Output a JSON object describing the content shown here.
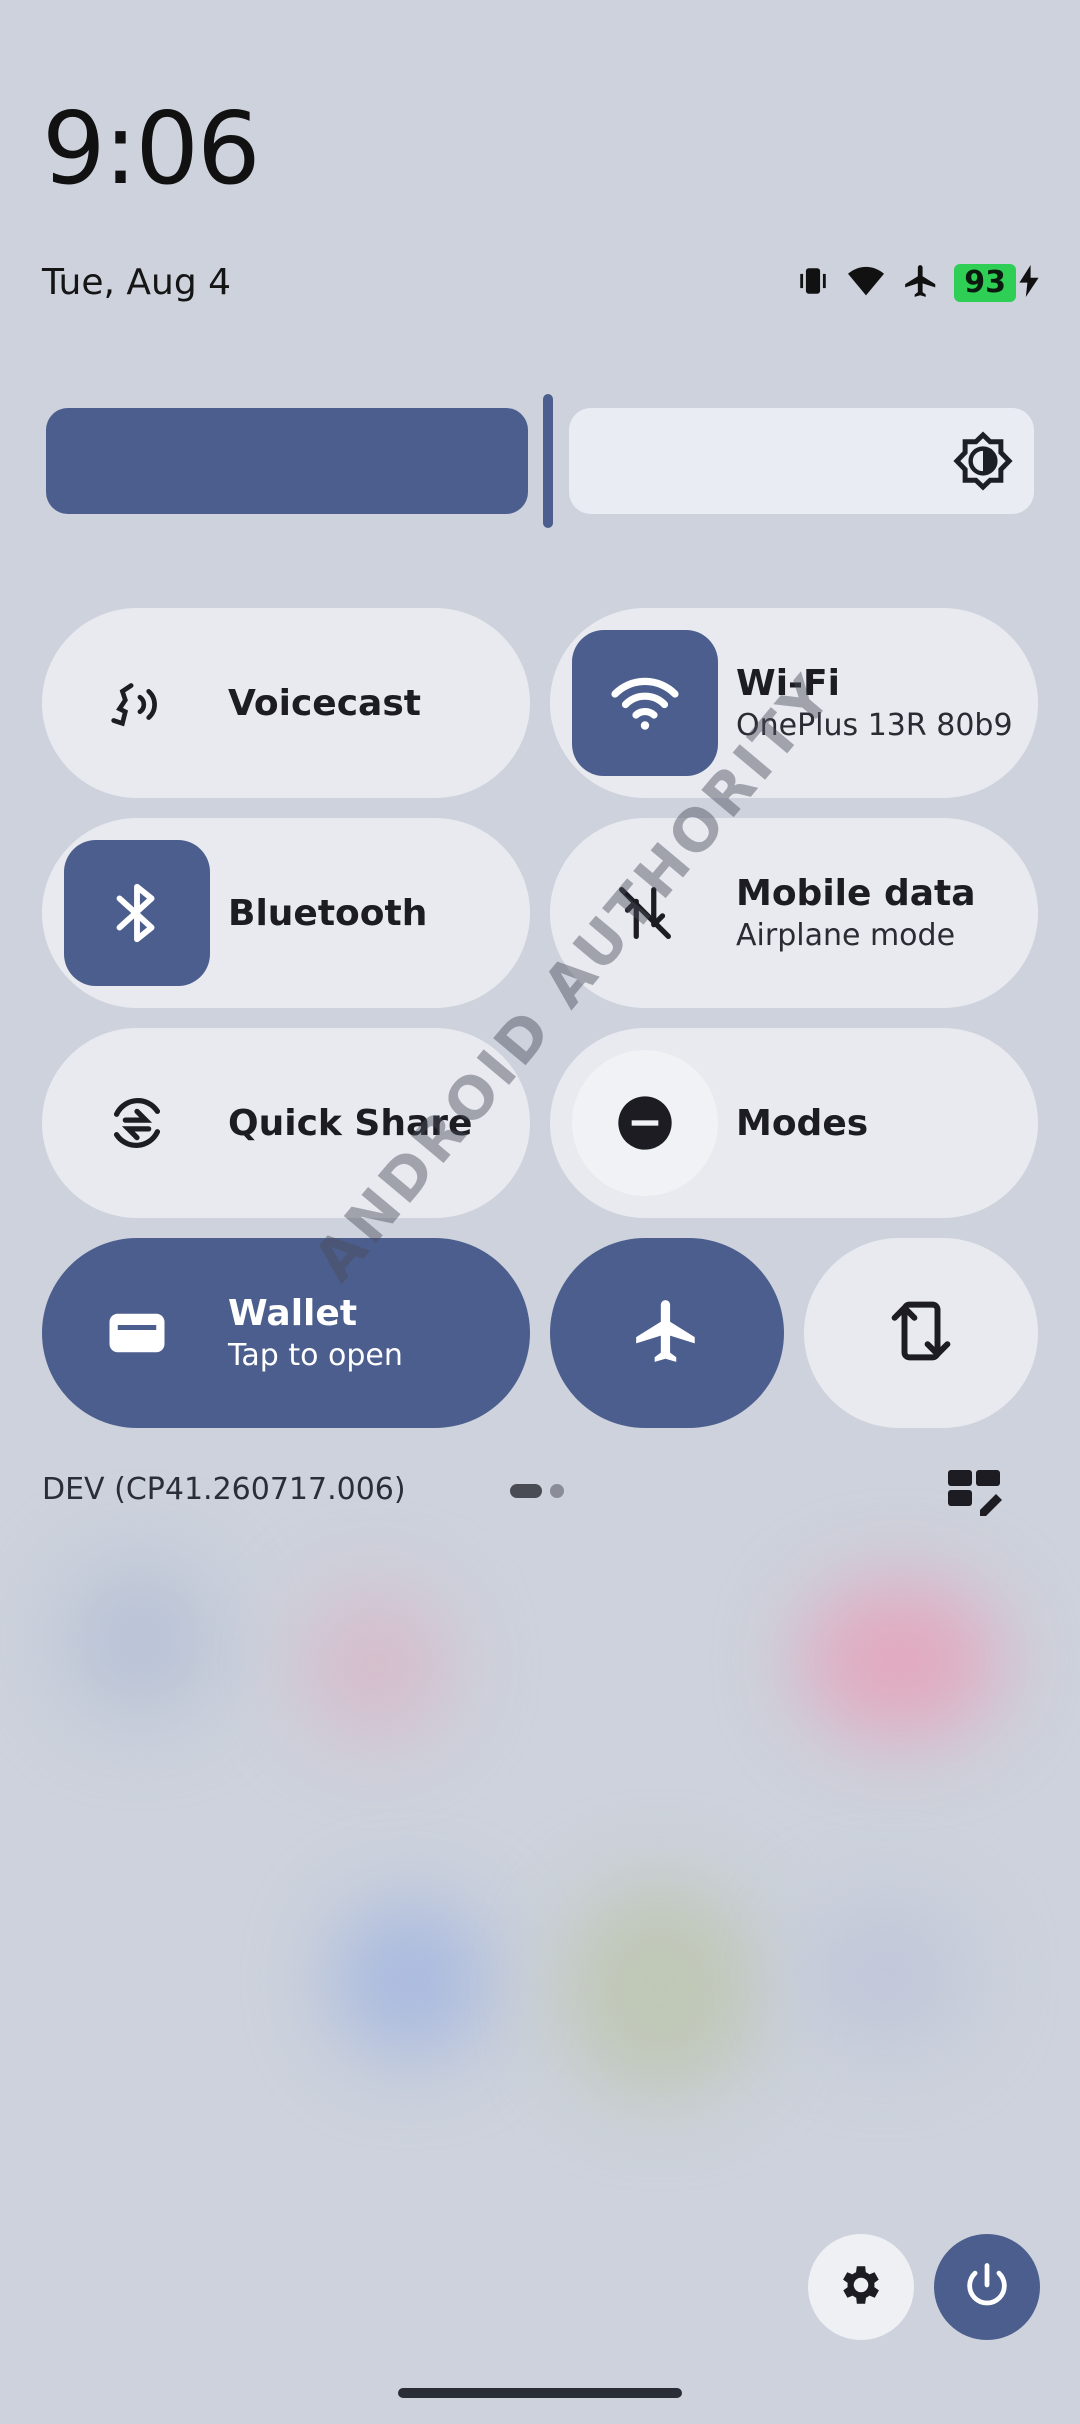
{
  "status_bar": {
    "time": "9:06",
    "date": "Tue, Aug 4",
    "battery_level": "93",
    "icons": [
      "vibrate-icon",
      "wifi-icon",
      "airplane-icon",
      "battery-icon",
      "charging-bolt-icon"
    ]
  },
  "brightness": {
    "level_fraction": 0.49,
    "icon": "brightness-icon"
  },
  "tiles": {
    "voicecast": {
      "title": "Voicecast",
      "icon": "voicecast-icon"
    },
    "wifi": {
      "title": "Wi-Fi",
      "subtitle": "OnePlus 13R 80b9",
      "icon": "wifi-icon"
    },
    "bluetooth": {
      "title": "Bluetooth",
      "icon": "bluetooth-icon"
    },
    "mobile_data": {
      "title": "Mobile data",
      "subtitle": "Airplane mode",
      "icon": "mobile-data-off-icon"
    },
    "quick_share": {
      "title": "Quick Share",
      "icon": "quick-share-icon"
    },
    "modes": {
      "title": "Modes",
      "icon": "do-not-disturb-icon"
    },
    "wallet": {
      "title": "Wallet",
      "subtitle": "Tap to open",
      "icon": "wallet-icon"
    },
    "airplane": {
      "icon": "airplane-icon"
    },
    "rotate": {
      "icon": "auto-rotate-icon"
    }
  },
  "footer": {
    "build": "DEV (CP41.260717.006)",
    "page_count": 2,
    "current_page": 1
  },
  "watermark": "ANDROID AUTHORITY",
  "colors": {
    "accent": "#4c5e8d",
    "tile_inactive": "#e8eaf0",
    "battery": "#2fcf56"
  }
}
